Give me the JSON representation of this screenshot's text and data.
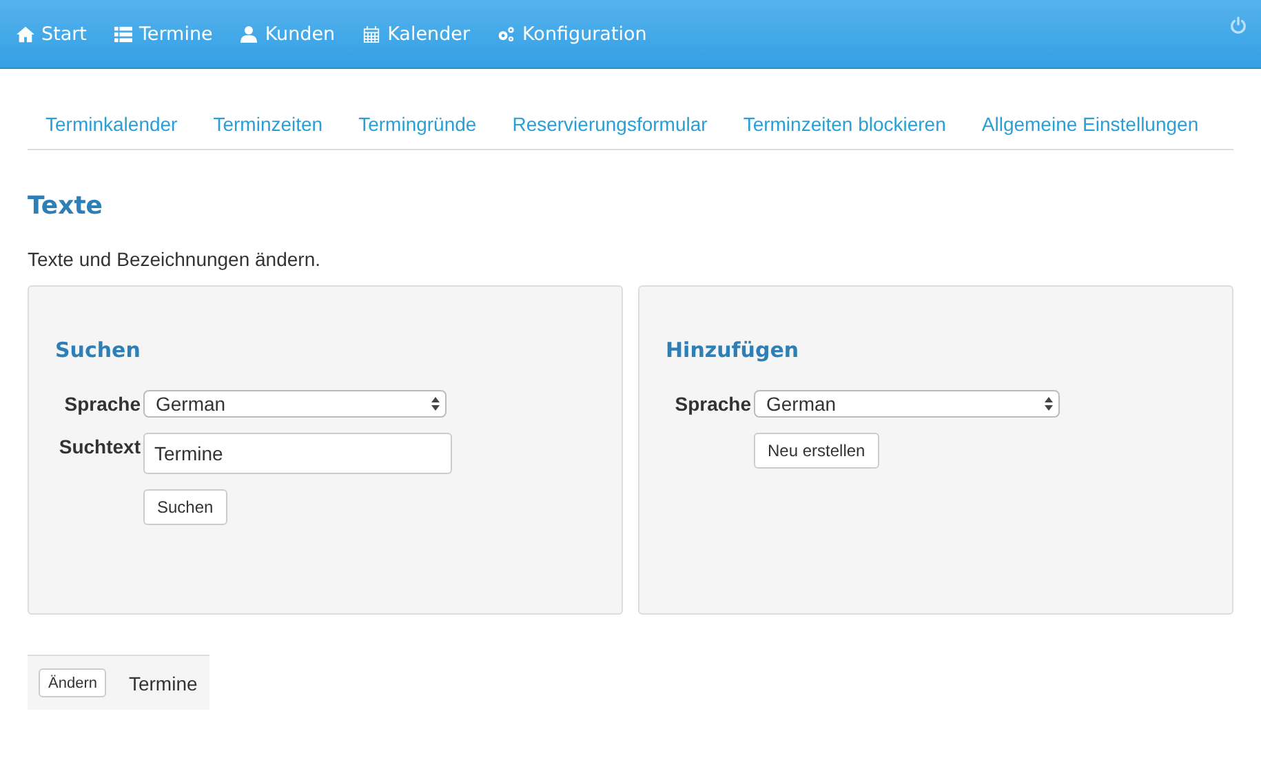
{
  "nav": [
    {
      "label": "Start",
      "kind": "home"
    },
    {
      "label": "Termine",
      "kind": "list"
    },
    {
      "label": "Kunden",
      "kind": "user"
    },
    {
      "label": "Kalender",
      "kind": "calendar"
    },
    {
      "label": "Konfiguration",
      "kind": "cogs"
    }
  ],
  "subtabs": [
    "Terminkalender",
    "Terminzeiten",
    "Termingründe",
    "Reservierungsformular",
    "Terminzeiten blockieren",
    "Allgemeine Einstellungen"
  ],
  "title": "Texte",
  "description": "Texte und Bezeichnungen ändern.",
  "search_panel": {
    "title": "Suchen",
    "language_label": "Sprache",
    "language": "German",
    "text_label": "Suchtext",
    "text_value": "Termine",
    "button": "Suchen"
  },
  "add_panel": {
    "title": "Hinzufügen",
    "language_label": "Sprache",
    "language": "German",
    "button": "Neu erstellen"
  },
  "results": [
    {
      "button": "Ändern",
      "text": "Termine"
    }
  ]
}
